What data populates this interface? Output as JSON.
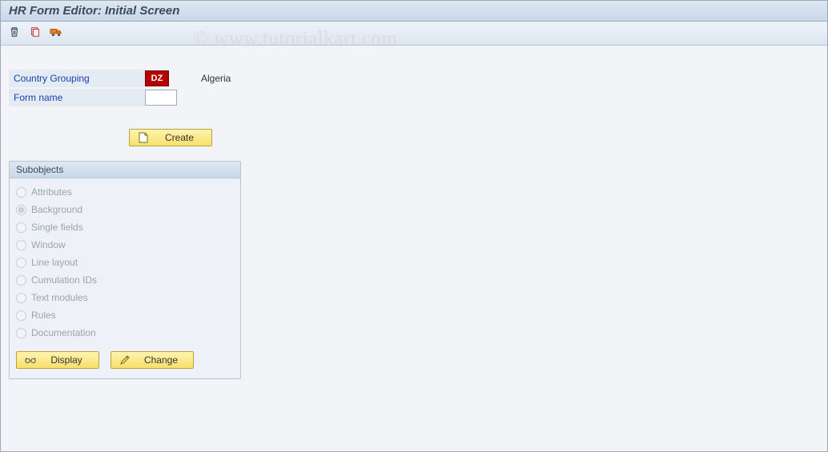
{
  "header": {
    "title": "HR Form Editor: Initial Screen"
  },
  "toolbar": {
    "delete_tooltip": "Delete",
    "copy_tooltip": "Copy",
    "transport_tooltip": "Transport"
  },
  "fields": {
    "country_grouping": {
      "label": "Country Grouping",
      "code": "DZ",
      "description": "Algeria"
    },
    "form_name": {
      "label": "Form name",
      "value": ""
    }
  },
  "buttons": {
    "create": "Create",
    "display": "Display",
    "change": "Change"
  },
  "subobjects": {
    "title": "Subobjects",
    "items": [
      {
        "label": "Attributes",
        "selected": false
      },
      {
        "label": "Background",
        "selected": true
      },
      {
        "label": "Single fields",
        "selected": false
      },
      {
        "label": "Window",
        "selected": false
      },
      {
        "label": "Line layout",
        "selected": false
      },
      {
        "label": "Cumulation IDs",
        "selected": false
      },
      {
        "label": "Text modules",
        "selected": false
      },
      {
        "label": "Rules",
        "selected": false
      },
      {
        "label": "Documentation",
        "selected": false
      }
    ]
  },
  "watermark": "© www.tutorialkart.com"
}
